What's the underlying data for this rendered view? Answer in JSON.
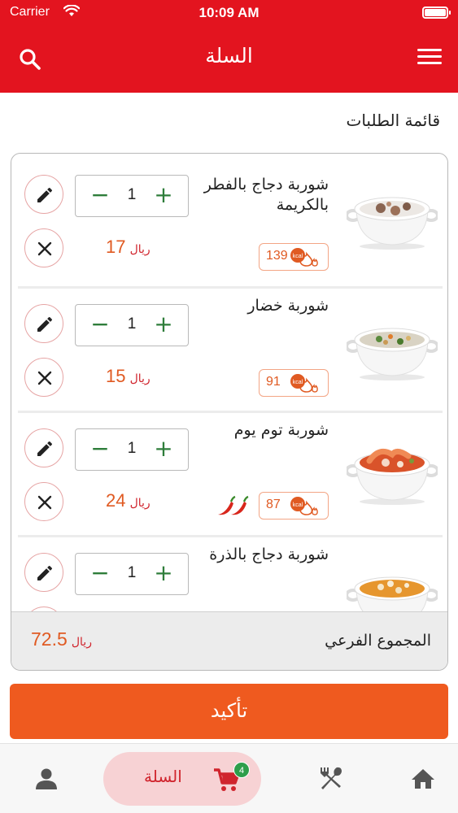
{
  "status_bar": {
    "carrier": "Carrier",
    "time": "10:09 AM"
  },
  "header": {
    "title": "السلة"
  },
  "section_title": "قائمة الطلبات",
  "items": [
    {
      "name": "شوربة دجاج بالفطر بالكريمة",
      "kcal": "139",
      "price": "17",
      "currency": "ريال",
      "quantity": "1",
      "spicy": false
    },
    {
      "name": "شوربة خضار",
      "kcal": "91",
      "price": "15",
      "currency": "ريال",
      "quantity": "1",
      "spicy": false
    },
    {
      "name": "شوربة توم يوم",
      "kcal": "87",
      "price": "24",
      "currency": "ريال",
      "quantity": "1",
      "spicy": true
    },
    {
      "name": "شوربة دجاج بالذرة",
      "quantity": "1",
      "spicy": false
    }
  ],
  "subtotal": {
    "label": "المجموع الفرعي",
    "amount": "72.5",
    "currency": "ريال"
  },
  "confirm_label": "تأكيد",
  "tabs": {
    "cart_label": "السلة",
    "cart_count": "4"
  },
  "colors": {
    "brand_red": "#e3141f",
    "confirm_orange": "#ef5a1f",
    "qty_green": "#2e7d3a",
    "cart_tab_bg": "#f7d2d4"
  },
  "icons": [
    "search-icon",
    "menu-icon",
    "edit-icon",
    "close-icon",
    "kcal-flame-icon",
    "chili-pepper-icon",
    "home-icon",
    "utensils-icon",
    "cart-icon",
    "user-icon"
  ]
}
